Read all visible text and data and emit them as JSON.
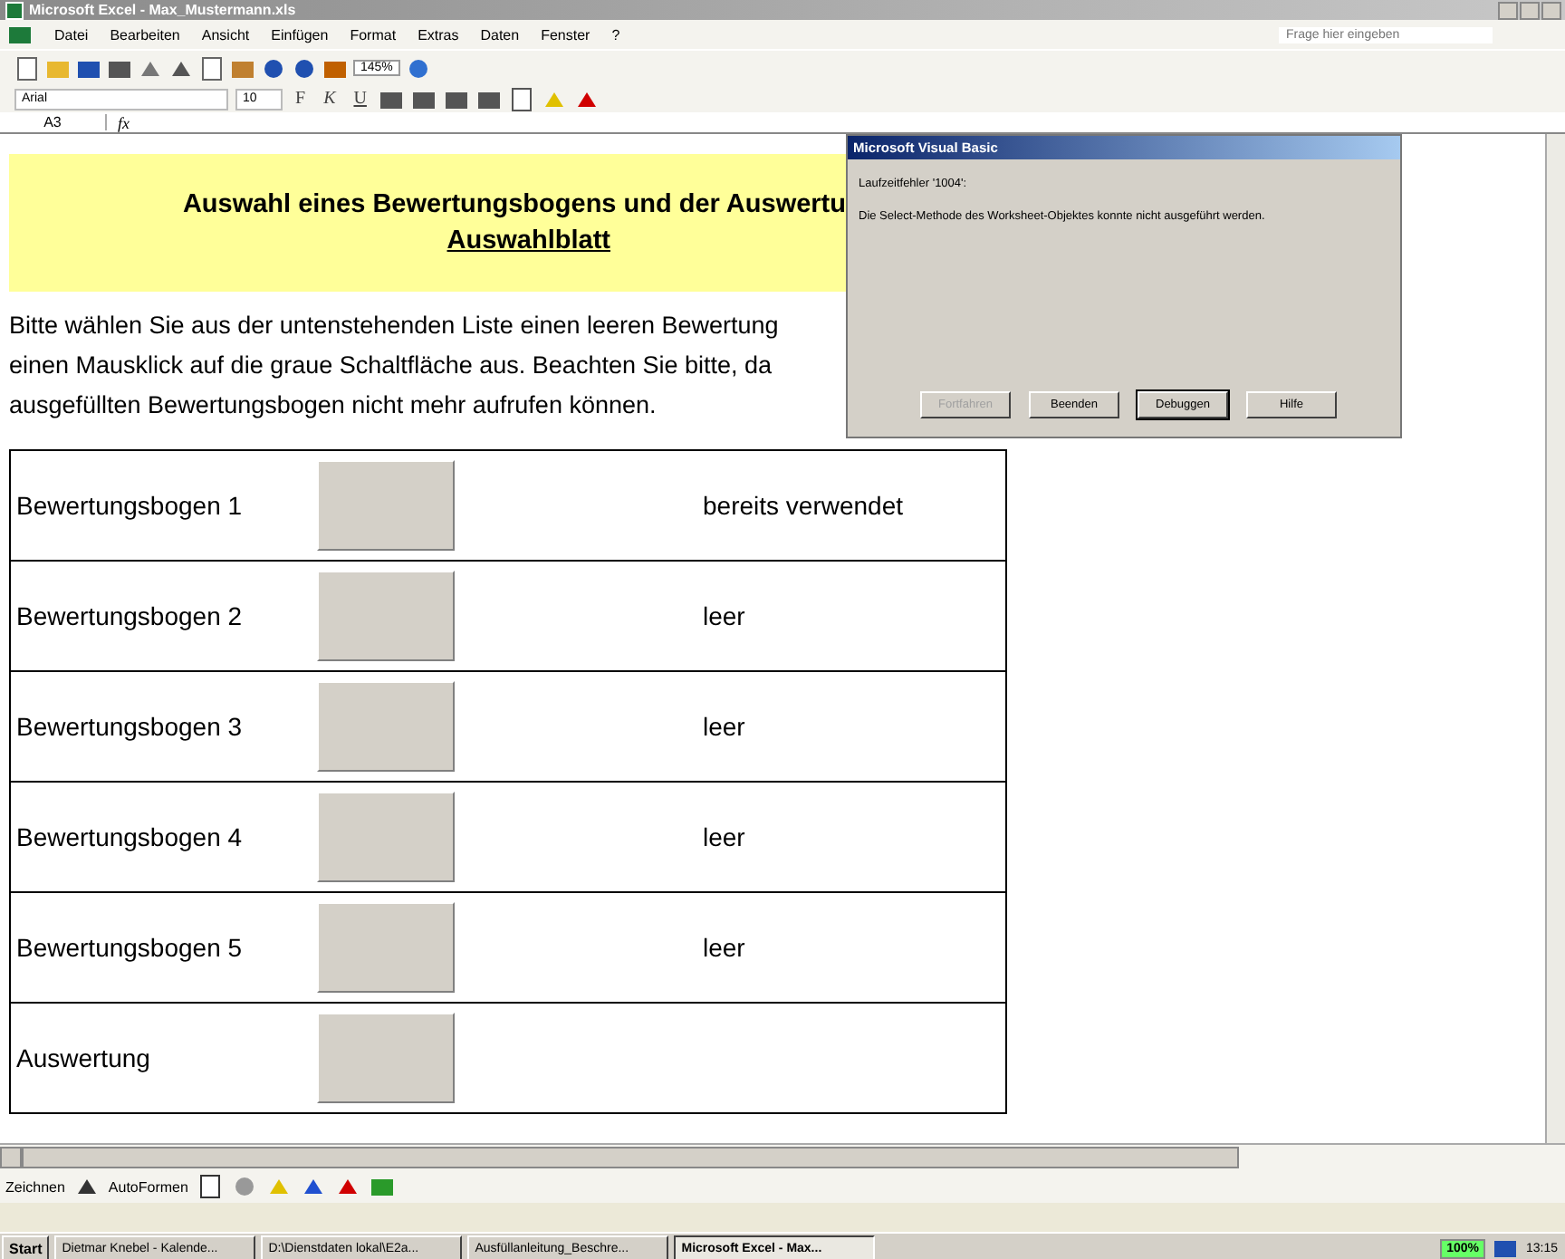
{
  "window": {
    "title": "Microsoft Excel - Max_Mustermann.xls"
  },
  "menu": {
    "items": [
      "Datei",
      "Bearbeiten",
      "Ansicht",
      "Einfügen",
      "Format",
      "Extras",
      "Daten",
      "Fenster",
      "?"
    ],
    "help_placeholder": "Frage hier eingeben"
  },
  "standard_toolbar": {
    "zoom": "145%"
  },
  "format_toolbar": {
    "font": "Arial",
    "size": "10",
    "bold": "F",
    "italic": "K",
    "underline": "U"
  },
  "formula_bar": {
    "name_box": "A3",
    "fx": "fx"
  },
  "sheet": {
    "title": "Auswahl eines Bewertungsbogens und der Auswertu",
    "subtitle": "Auswahlblatt",
    "paragraph": [
      "Bitte wählen Sie aus der untenstehenden Liste einen leeren Bewertung",
      "einen Mausklick auf die graue Schaltfläche aus. Beachten Sie bitte, da",
      "ausgefüllten Bewertungsbogen nicht mehr aufrufen können."
    ],
    "rows": [
      {
        "label": "Bewertungsbogen 1",
        "status": "bereits verwendet"
      },
      {
        "label": "Bewertungsbogen 2",
        "status": "leer"
      },
      {
        "label": "Bewertungsbogen 3",
        "status": "leer"
      },
      {
        "label": "Bewertungsbogen 4",
        "status": "leer"
      },
      {
        "label": "Bewertungsbogen 5",
        "status": "leer"
      },
      {
        "label": "Auswertung"
      }
    ]
  },
  "dialog": {
    "title": "Microsoft Visual Basic",
    "error": "Laufzeitfehler '1004':",
    "message": "Die Select-Methode des Worksheet-Objektes konnte nicht ausgeführt werden.",
    "buttons": [
      {
        "label": "Fortfahren",
        "disabled": true,
        "selected": false
      },
      {
        "label": "Beenden",
        "disabled": false,
        "selected": false
      },
      {
        "label": "Debuggen",
        "disabled": false,
        "selected": true
      },
      {
        "label": "Hilfe",
        "disabled": false,
        "selected": false
      }
    ]
  },
  "drawing_toolbar": {
    "draw": "Zeichnen",
    "autoshapes": "AutoFormen"
  },
  "taskbar": {
    "start": "Start",
    "tasks": [
      {
        "label": "Dietmar Knebel - Kalende...",
        "selected": false
      },
      {
        "label": "D:\\Dienstdaten lokal\\E2a...",
        "selected": false
      },
      {
        "label": "Ausfüllanleitung_Beschre...",
        "selected": false
      },
      {
        "label": "Microsoft Excel - Max...",
        "selected": true
      }
    ],
    "battery": "100%",
    "clock": "13:15"
  }
}
